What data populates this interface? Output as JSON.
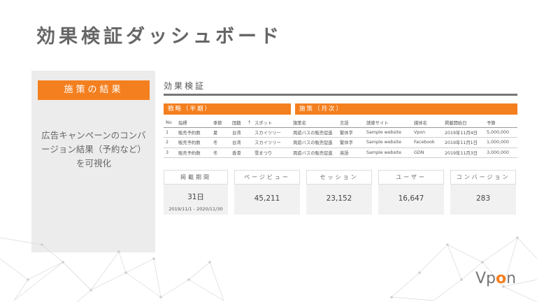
{
  "page_title": "効果検証ダッシュボード",
  "left": {
    "label": "施策の結果",
    "description": "広告キャンペーンのコンバージョン結果（予約など）を可視化"
  },
  "section_title": "効果検証",
  "groups": {
    "strategy": "戦略（半期）",
    "measures": "施策（月次）"
  },
  "table": {
    "headers": [
      "No",
      "指標",
      "季節",
      "国籍",
      "↑",
      "スポット",
      "施策名",
      "言語",
      "誘導サイト",
      "媒体名",
      "掲載開始日",
      "予算"
    ],
    "rows": [
      [
        "1",
        "販売予約数",
        "夏",
        "台湾",
        "",
        "スカイツリー",
        "周遊バスの販売促進",
        "繁体字",
        "Sample website",
        "Vpon",
        "2019年11月4日",
        "5,000,000"
      ],
      [
        "2",
        "販売予約数",
        "冬",
        "台湾",
        "",
        "スカイツリー",
        "周遊バスの販売促進",
        "繁体字",
        "Sample website",
        "Facebook",
        "2019年11月1日",
        "1,000,000"
      ],
      [
        "3",
        "販売予約数",
        "冬",
        "香港",
        "",
        "雪まつり",
        "周遊バスの販売促進",
        "英語",
        "Sample website",
        "GDN",
        "2019年11月3日",
        "3,000,000"
      ]
    ]
  },
  "cards": [
    {
      "label": "掲載期間",
      "value": "31日",
      "sub": "2019/11/1 - 2020/11/30"
    },
    {
      "label": "ページビュー",
      "value": "45,211"
    },
    {
      "label": "セッション",
      "value": "23,152"
    },
    {
      "label": "ユーザー",
      "value": "16,647"
    },
    {
      "label": "コンバージョン",
      "value": "283"
    }
  ],
  "logo": {
    "prefix": "Vp",
    "accent": "o",
    "suffix": "n"
  },
  "colors": {
    "accent": "#f47f1f",
    "panel": "#ececec"
  }
}
